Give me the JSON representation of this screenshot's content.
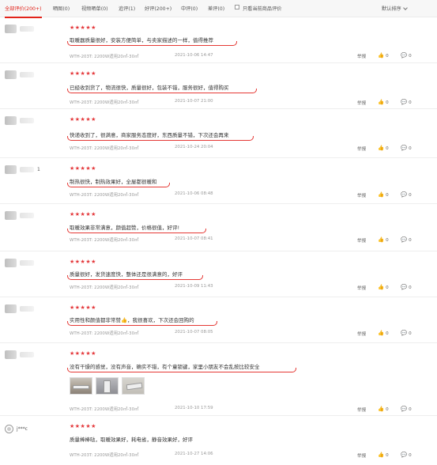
{
  "tabs": {
    "all": "全部评价(200+)",
    "pic": "晒图(0)",
    "video": "视频晒单(0)",
    "append": "追评(1)",
    "good": "好评(200+)",
    "mid": "中评(0)",
    "bad": "差评(0)",
    "only_current": "只看当前商品评价",
    "sort": "默认排序"
  },
  "actions": {
    "report": "举报"
  },
  "reviews": [
    {
      "stars": "★★★★★",
      "user": "",
      "content": "取暖器质量很好，安装方便简单，与卖家描述的一样，值得推荐",
      "spec": "WTH-203T:  2200W适用20㎡-30㎡",
      "date": "2021-10-06 14:47",
      "likes": "0",
      "replies": "0"
    },
    {
      "stars": "★★★★★",
      "user": "",
      "content": "已经收到货了，物流很快，质量很好，包装不错，服务很好，值得购买",
      "spec": "WTH-203T:  2200W适用20㎡-30㎡",
      "date": "2021-10-07 21:00",
      "likes": "0",
      "replies": "0"
    },
    {
      "stars": "★★★★★",
      "user": "",
      "content": "快递收到了，很满意，商家服务态度好，东西质量不错，下次还会再来",
      "spec": "WTH-203T:  2200W适用20㎡-30㎡",
      "date": "2021-10-24 20:04",
      "likes": "0",
      "replies": "0"
    },
    {
      "stars": "★★★★★",
      "user": "1",
      "content": "制热很快，制热效果好，全屋都很暖和",
      "spec": "WTH-203T:  2200W适用20㎡-30㎡",
      "date": "2021-10-06 08:48",
      "likes": "0",
      "replies": "0"
    },
    {
      "stars": "★★★★★",
      "user": "",
      "content": "取暖效果非常满意，颜值超赞，价格很值，好评!",
      "spec": "WTH-203T:  2200W适用20㎡-30㎡",
      "date": "2021-10-07 08:41",
      "likes": "0",
      "replies": "0"
    },
    {
      "stars": "★★★★★",
      "user": "",
      "content": "质量很好，发货速度快，整体还是很满意的，好评",
      "spec": "WTH-203T:  2200W适用20㎡-30㎡",
      "date": "2021-10-09 11:43",
      "likes": "0",
      "replies": "0"
    },
    {
      "stars": "★★★★★",
      "user": "",
      "content": "实用性和颜值都非常赞👍，我很喜欢，下次还会回购的",
      "spec": "WTH-203T:  2200W适用20㎡-30㎡",
      "date": "2021-10-07 08:05",
      "likes": "0",
      "replies": "0"
    },
    {
      "stars": "★★★★★",
      "user": "",
      "content": "没有干燥的感觉，没有声音，确实不错，有个童锁键，家里小朋友不会乱按比较安全",
      "spec": "WTH-203T:  2200W适用20㎡-30㎡",
      "date": "2021-10-10 17:59",
      "likes": "0",
      "replies": "0"
    },
    {
      "stars": "★★★★★",
      "user": "j***c",
      "content": "质量棒棒哒，取暖效果好，耗电省，静音效果好，好评",
      "spec": "WTH-203T:  2200W适用20㎡-30㎡",
      "date": "2021-10-27 14:06",
      "likes": "0",
      "replies": "0"
    }
  ]
}
